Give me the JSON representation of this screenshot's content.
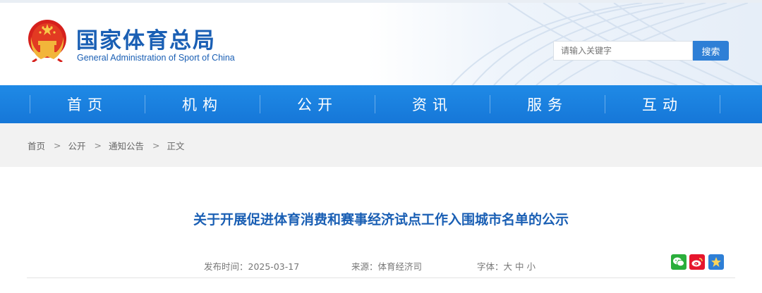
{
  "header": {
    "title_zh": "国家体育总局",
    "title_en": "General Administration of Sport of China",
    "search_placeholder": "请输入关键字",
    "search_button": "搜索"
  },
  "nav": {
    "items": [
      "首页",
      "机构",
      "公开",
      "资讯",
      "服务",
      "互动"
    ]
  },
  "breadcrumb": {
    "items": [
      "首页",
      "公开",
      "通知公告",
      "正文"
    ],
    "separator": ">"
  },
  "article": {
    "title": "关于开展促进体育消费和赛事经济试点工作入围城市名单的公示",
    "publish_time": "发布时间：2025-03-17",
    "source": "来源：体育经济司",
    "font_size_label": "字体：",
    "font_sizes": [
      "大",
      "中",
      "小"
    ]
  },
  "share": {
    "icons": [
      "wechat-icon",
      "weibo-icon",
      "favorite-icon"
    ],
    "colors": {
      "wechat": "#2aae3b",
      "weibo": "#e6162d",
      "favorite": "#2e7fd6"
    }
  },
  "colors": {
    "brand": "#1a5fb4",
    "nav": "#1a80e0"
  }
}
